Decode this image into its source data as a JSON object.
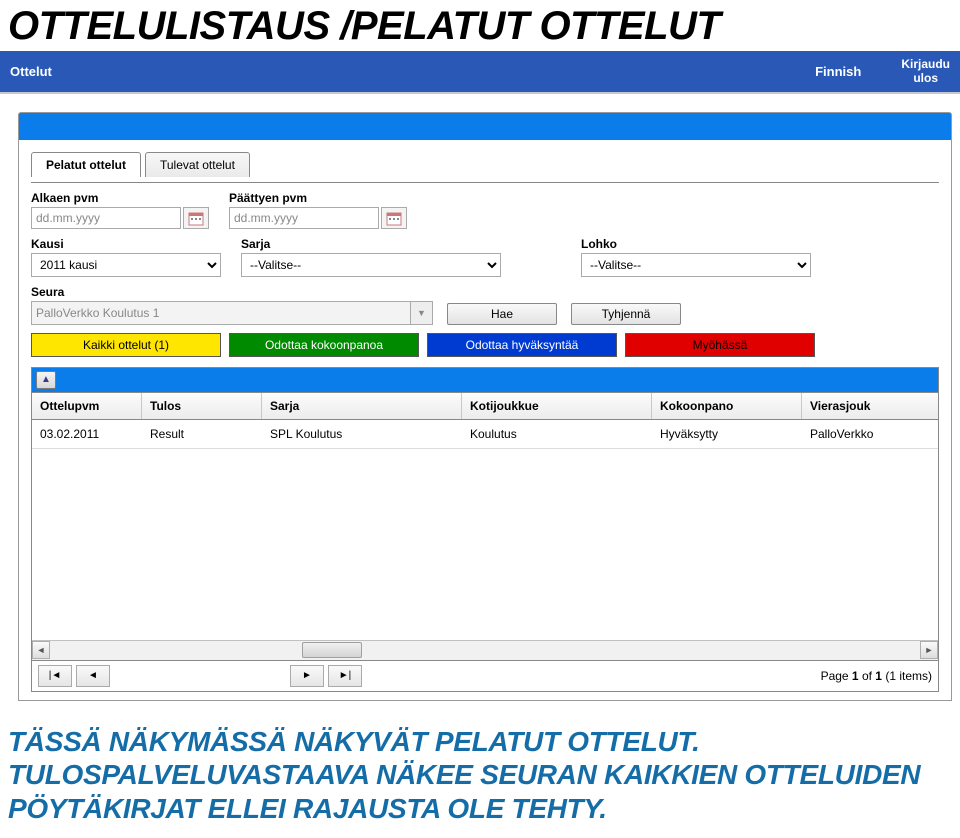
{
  "page": {
    "title_main": "OTTELULISTAUS /",
    "title_sub": "PELATUT OTTELUT"
  },
  "topbar": {
    "ottelut": "Ottelut",
    "lang": "Finnish",
    "logout_l1": "Kirjaudu",
    "logout_l2": "ulos"
  },
  "tabs": {
    "played": "Pelatut ottelut",
    "upcoming": "Tulevat ottelut"
  },
  "labels": {
    "from": "Alkaen pvm",
    "to": "Päättyen pvm",
    "season": "Kausi",
    "series": "Sarja",
    "group": "Lohko",
    "club": "Seura"
  },
  "placeholders": {
    "date": "dd.mm.yyyy"
  },
  "values": {
    "season": "2011 kausi",
    "series": "--Valitse--",
    "group": "--Valitse--",
    "club": "PalloVerkko Koulutus 1"
  },
  "buttons": {
    "search": "Hae",
    "clear": "Tyhjennä"
  },
  "status": {
    "all": "Kaikki ottelut (1)",
    "lineup": "Odottaa kokoonpanoa",
    "approve": "Odottaa hyväksyntää",
    "late": "Myöhässä"
  },
  "grid": {
    "headers": {
      "date": "Ottelupvm",
      "result": "Tulos",
      "series": "Sarja",
      "home": "Kotijoukkue",
      "lineup": "Kokoonpano",
      "away": "Vierasjouk"
    },
    "rows": [
      {
        "date": "03.02.2011",
        "result": "Result",
        "series": "SPL Koulutus",
        "home": "Koulutus",
        "lineup": "Hyväksytty",
        "away": "PalloVerkko"
      }
    ]
  },
  "pager": {
    "text_pre": "Page ",
    "cur": "1",
    "text_mid": " of ",
    "total": "1",
    "text_items": " (1 items)"
  },
  "caption": {
    "line1": "TÄSSÄ NÄKYMÄSSÄ NÄKYVÄT PELATUT OTTELUT.",
    "line2": "TULOSPALVELUVASTAAVA NÄKEE SEURAN KAIKKIEN OTTELUIDEN PÖYTÄKIRJAT ELLEI RAJAUSTA OLE TEHTY."
  }
}
